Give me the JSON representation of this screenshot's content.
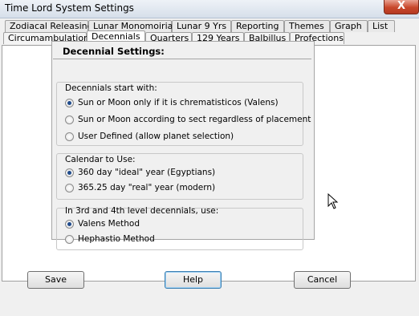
{
  "window": {
    "title": "Time Lord System Settings",
    "close_glyph": "X"
  },
  "tabs_row1": [
    "Zodiacal Releasing",
    "Lunar Monomoiria",
    "Lunar 9 Yrs",
    "Reporting",
    "Themes",
    "Graph",
    "List"
  ],
  "tabs_row2": [
    "Circumambulations",
    "Decennials",
    "Quarters",
    "129 Years",
    "Balbillus",
    "Profections"
  ],
  "active_tab": "Decennials",
  "section": {
    "title": "Decennial Settings:",
    "start_group": {
      "label": "Decennials start with:",
      "options": [
        {
          "label": "Sun or Moon only if it is chrematisticos (Valens)",
          "selected": true
        },
        {
          "label": "Sun or Moon according to sect regardless of placement",
          "selected": false
        },
        {
          "label": "User Defined (allow planet selection)",
          "selected": false
        }
      ]
    },
    "calendar_group": {
      "label": "Calendar to Use:",
      "options": [
        {
          "label": "360 day \"ideal\" year (Egyptians)",
          "selected": true
        },
        {
          "label": "365.25 day \"real\" year (modern)",
          "selected": false
        }
      ]
    },
    "level_group": {
      "label": "In 3rd and 4th level decennials, use:",
      "options": [
        {
          "label": "Valens Method",
          "selected": true
        },
        {
          "label": "Hephastio Method",
          "selected": false
        }
      ]
    }
  },
  "buttons": {
    "save": "Save",
    "help": "Help",
    "cancel": "Cancel"
  }
}
